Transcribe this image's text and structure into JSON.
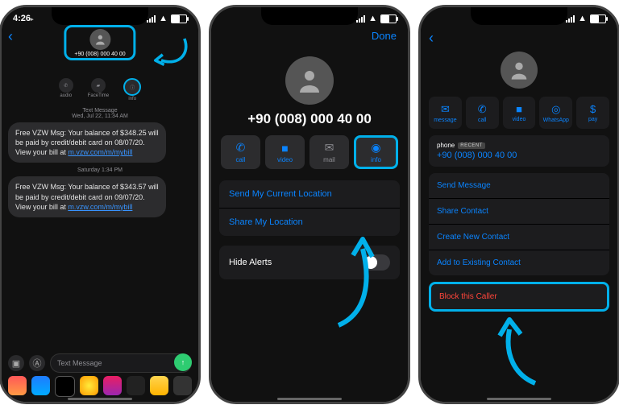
{
  "status": {
    "time": "4:26",
    "time_suffix": "▸"
  },
  "phone1": {
    "contact_number": "+90 (008) 000 40 00",
    "nav_actions": {
      "audio": "audio",
      "facetime": "FaceTime",
      "info": "info"
    },
    "ts1_label": "Text Message",
    "ts1_date": "Wed, Jul 22, 11:34 AM",
    "msg1_prefix": "Free VZW Msg: Your balance of $348.25 will be paid by credit/debit card on 08/07/20. View your bill at ",
    "msg1_link": "m.vzw.com/m/mybill",
    "ts2": "Saturday 1:34 PM",
    "msg2_prefix": "Free VZW Msg: Your balance of $343.57 will be paid by credit/debit card on 09/07/20. View your bill at ",
    "msg2_link": "m.vzw.com/m/mybill",
    "composer_placeholder": "Text Message"
  },
  "phone2": {
    "done": "Done",
    "number": "+90 (008) 000 40 00",
    "actions": {
      "call": "call",
      "video": "video",
      "mail": "mail",
      "info": "info"
    },
    "send_location": "Send My Current Location",
    "share_location": "Share My Location",
    "hide_alerts": "Hide Alerts"
  },
  "phone3": {
    "actions": {
      "message": "message",
      "call": "call",
      "video": "video",
      "whatsapp": "WhatsApp",
      "pay": "pay"
    },
    "phone_label": "phone",
    "recent_badge": "RECENT",
    "phone_value": "+90 (008) 000 40 00",
    "send_message": "Send Message",
    "share_contact": "Share Contact",
    "create_contact": "Create New Contact",
    "add_existing": "Add to Existing Contact",
    "block": "Block this Caller"
  }
}
